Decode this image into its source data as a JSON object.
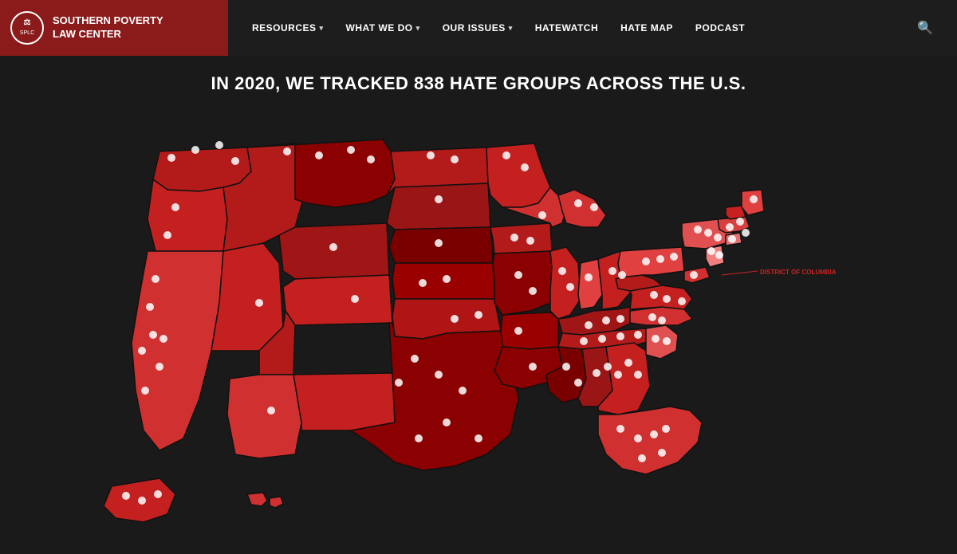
{
  "header": {
    "logo_line1": "Southern Poverty",
    "logo_line2": "Law Center",
    "nav_items": [
      {
        "label": "RESOURCES",
        "has_dropdown": true
      },
      {
        "label": "WHAT WE DO",
        "has_dropdown": true
      },
      {
        "label": "OUR ISSUES",
        "has_dropdown": true
      },
      {
        "label": "HATEWATCH",
        "has_dropdown": false
      },
      {
        "label": "HATE MAP",
        "has_dropdown": false
      },
      {
        "label": "PODCAST",
        "has_dropdown": false
      }
    ]
  },
  "main": {
    "headline": "IN 2020, WE TRACKED 838 HATE GROUPS ACROSS THE U.S.",
    "dc_label": "DISTRICT OF COLUMBIA"
  },
  "colors": {
    "background": "#1a1a1a",
    "logo_bg": "#8b1a1a",
    "map_dark": "#6b0000",
    "map_medium": "#b31b1b",
    "map_light": "#e05050",
    "map_lighter": "#f08080",
    "nav_bg": "#1e1e1e"
  }
}
